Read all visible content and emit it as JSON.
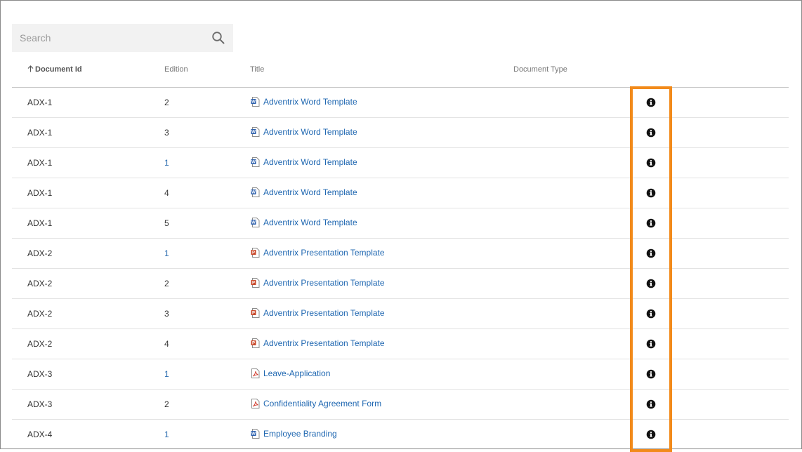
{
  "search": {
    "placeholder": "Search",
    "value": ""
  },
  "columns": {
    "document_id": "Document Id",
    "edition": "Edition",
    "title": "Title",
    "document_type": "Document Type"
  },
  "sort": {
    "column": "document_id",
    "direction": "ascending"
  },
  "highlight_color": "#f28a1a",
  "rows": [
    {
      "id": "ADX-1",
      "edition": "2",
      "title": "Adventrix Word Template",
      "file_icon": "word-file-icon",
      "info_icon": "info-icon"
    },
    {
      "id": "ADX-1",
      "edition": "3",
      "title": "Adventrix Word Template",
      "file_icon": "word-file-icon",
      "info_icon": "info-icon"
    },
    {
      "id": "ADX-1",
      "edition": "1",
      "title": "Adventrix Word Template",
      "file_icon": "word-file-icon",
      "info_icon": "info-icon"
    },
    {
      "id": "ADX-1",
      "edition": "4",
      "title": "Adventrix Word Template",
      "file_icon": "word-file-icon",
      "info_icon": "info-icon"
    },
    {
      "id": "ADX-1",
      "edition": "5",
      "title": "Adventrix Word Template",
      "file_icon": "word-file-icon",
      "info_icon": "info-icon"
    },
    {
      "id": "ADX-2",
      "edition": "1",
      "title": "Adventrix Presentation Template",
      "file_icon": "powerpoint-file-icon",
      "info_icon": "info-icon"
    },
    {
      "id": "ADX-2",
      "edition": "2",
      "title": "Adventrix Presentation Template",
      "file_icon": "powerpoint-file-icon",
      "info_icon": "info-icon"
    },
    {
      "id": "ADX-2",
      "edition": "3",
      "title": "Adventrix Presentation Template",
      "file_icon": "powerpoint-file-icon",
      "info_icon": "info-icon"
    },
    {
      "id": "ADX-2",
      "edition": "4",
      "title": "Adventrix Presentation Template",
      "file_icon": "powerpoint-file-icon",
      "info_icon": "info-icon"
    },
    {
      "id": "ADX-3",
      "edition": "1",
      "title": "Leave-Application",
      "file_icon": "pdf-file-icon",
      "info_icon": "info-icon"
    },
    {
      "id": "ADX-3",
      "edition": "2",
      "title": "Confidentiality Agreement Form",
      "file_icon": "pdf-file-icon",
      "info_icon": "info-icon"
    },
    {
      "id": "ADX-4",
      "edition": "1",
      "title": "Employee Branding",
      "file_icon": "word-file-icon",
      "info_icon": "info-icon"
    }
  ]
}
